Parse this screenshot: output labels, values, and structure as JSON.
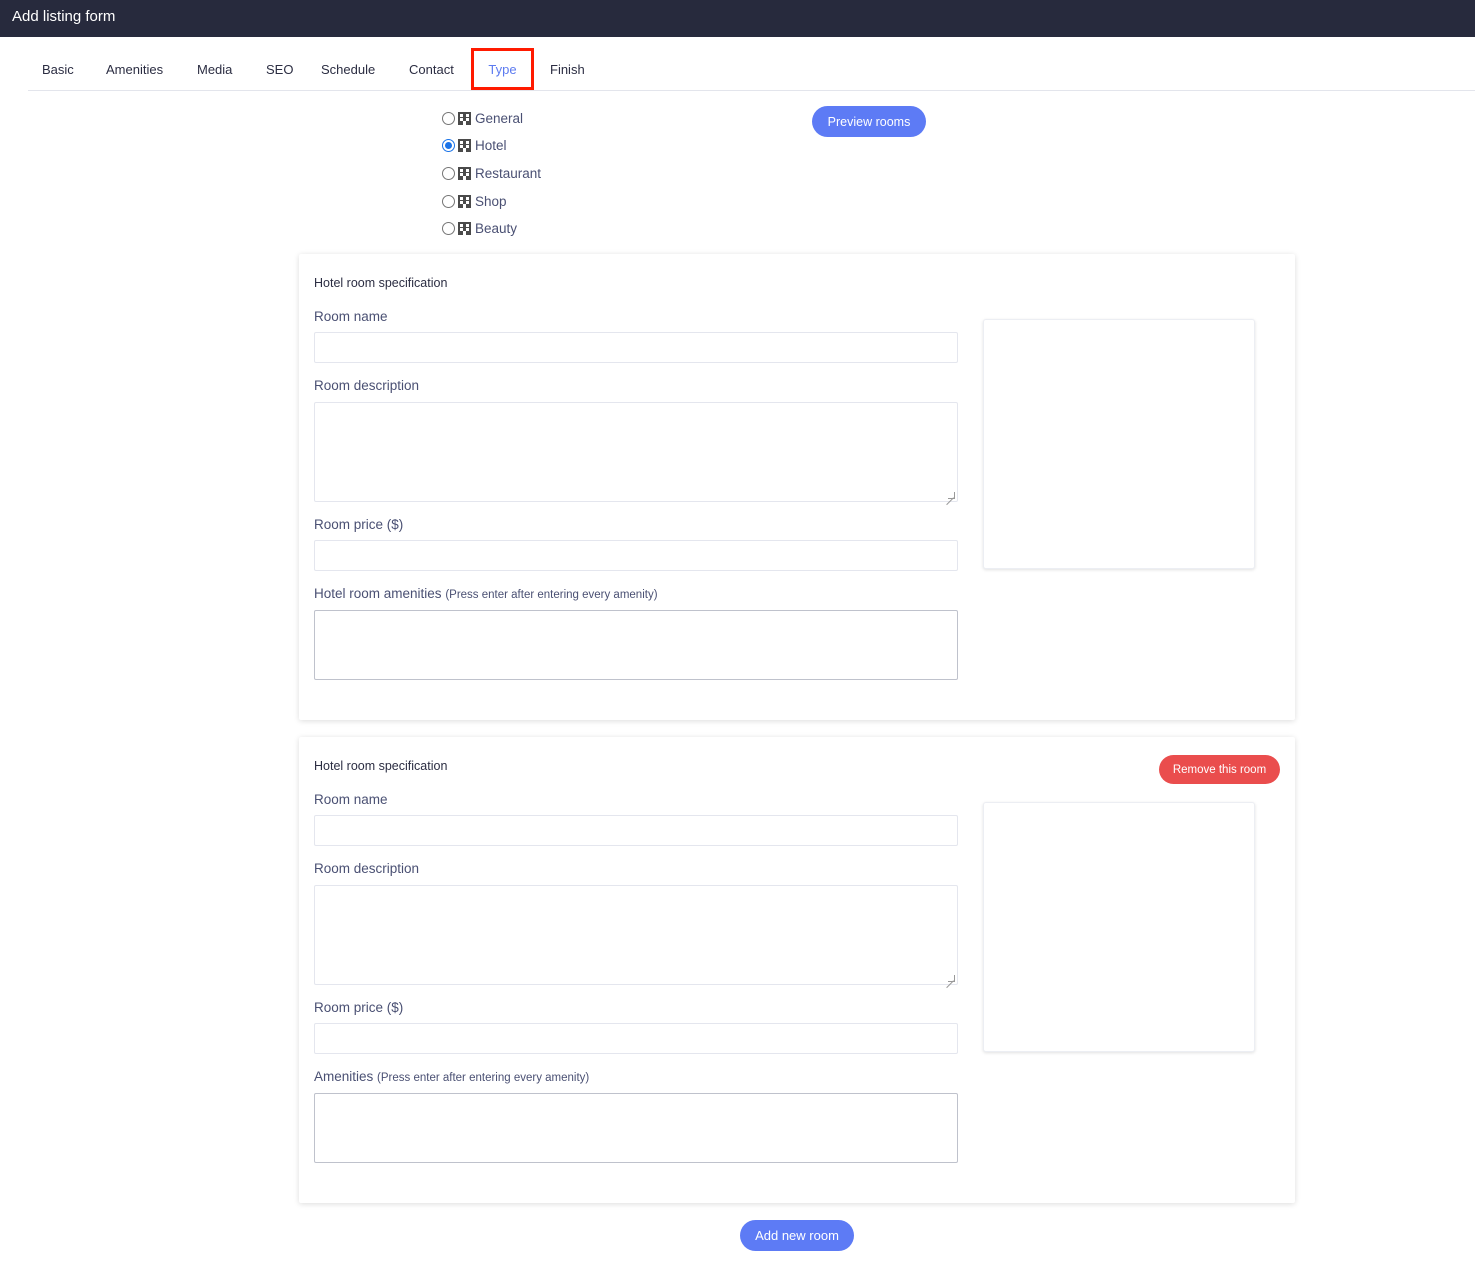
{
  "header": {
    "title": "Add listing form"
  },
  "tabs": [
    {
      "label": "Basic"
    },
    {
      "label": "Amenities"
    },
    {
      "label": "Media"
    },
    {
      "label": "SEO"
    },
    {
      "label": "Schedule"
    },
    {
      "label": "Contact"
    },
    {
      "label": "Type",
      "active": true
    },
    {
      "label": "Finish"
    }
  ],
  "listing_types": {
    "selected": "Hotel",
    "options": [
      {
        "label": "General",
        "icon": "building-icon"
      },
      {
        "label": "Hotel",
        "icon": "building-icon"
      },
      {
        "label": "Restaurant",
        "icon": "building-icon"
      },
      {
        "label": "Shop",
        "icon": "building-icon"
      },
      {
        "label": "Beauty",
        "icon": "building-icon"
      }
    ]
  },
  "preview_button": {
    "label": "Preview rooms"
  },
  "rooms": [
    {
      "title": "Hotel room specification",
      "room_name_label": "Room name",
      "room_name_value": "",
      "description_label": "Room description",
      "description_value": "",
      "price_label": "Room price ($)",
      "price_value": "",
      "amenities_label": "Hotel room amenities",
      "amenities_hint": "(Press enter after entering every amenity)",
      "amenities_value": ""
    },
    {
      "title": "Hotel room specification",
      "remove_label": "Remove this room",
      "room_name_label": "Room name",
      "room_name_value": "",
      "description_label": "Room description",
      "description_value": "",
      "price_label": "Room price ($)",
      "price_value": "",
      "amenities_label": "Amenities",
      "amenities_hint": "(Press enter after entering every amenity)",
      "amenities_value": ""
    }
  ],
  "add_room_button": {
    "label": "Add new room"
  },
  "colors": {
    "header_bg": "#272a3d",
    "accent": "#5d7bf5",
    "danger": "#ea4d4d",
    "highlight": "#ff1a00"
  }
}
